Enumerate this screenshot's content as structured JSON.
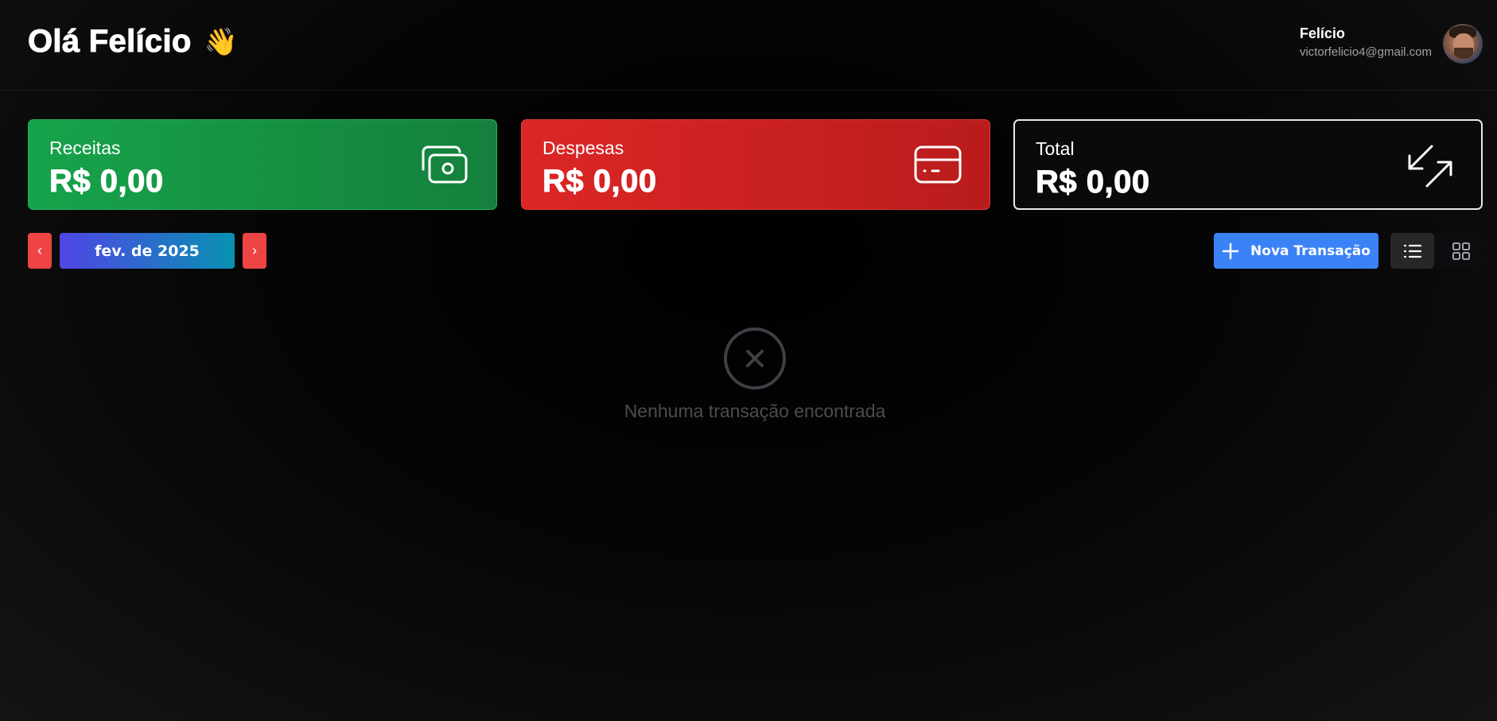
{
  "header": {
    "greeting": "Olá Felício",
    "greeting_emoji": "👋",
    "user_name": "Felício",
    "user_email": "victorfelicio4@gmail.com"
  },
  "cards": {
    "receitas": {
      "label": "Receitas",
      "value": "R$ 0,00",
      "icon": "money-bills-icon",
      "color": "#16a34a"
    },
    "despesas": {
      "label": "Despesas",
      "value": "R$ 0,00",
      "icon": "credit-card-icon",
      "color": "#dc2626"
    },
    "total": {
      "label": "Total",
      "value": "R$ 0,00",
      "icon": "arrows-diagonal-icon",
      "color": "#0a0a0b"
    }
  },
  "toolbar": {
    "prev_label": "‹",
    "next_label": "›",
    "month_label": "fev. de 2025",
    "new_transaction_label": "Nova Transação",
    "new_transaction_color": "#3b82f6",
    "view_mode": "list"
  },
  "empty_state": {
    "icon": "circle-x-icon",
    "message": "Nenhuma transação encontrada"
  }
}
